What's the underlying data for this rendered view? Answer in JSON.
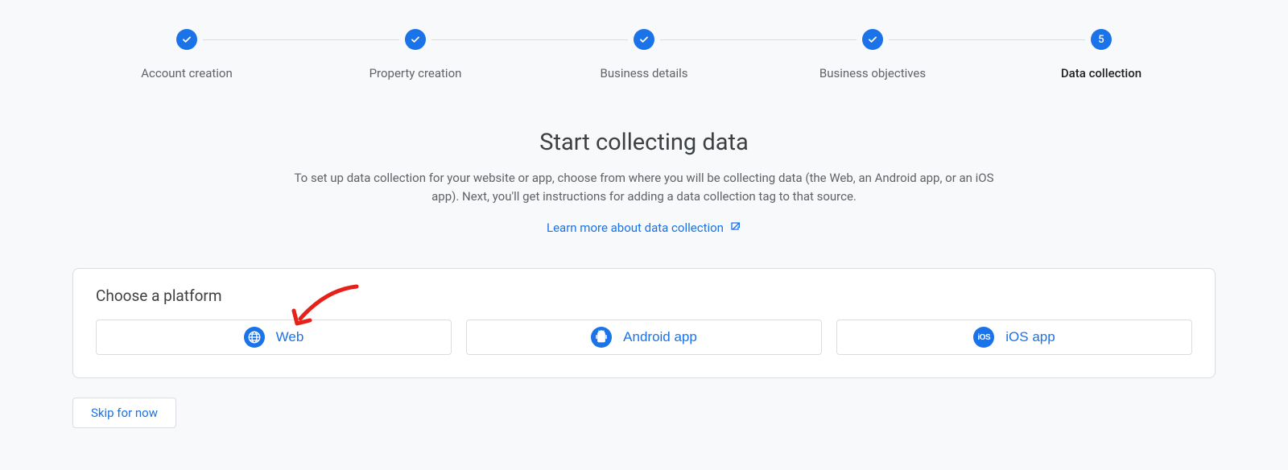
{
  "stepper": {
    "steps": [
      {
        "label": "Account creation",
        "completed": true
      },
      {
        "label": "Property creation",
        "completed": true
      },
      {
        "label": "Business details",
        "completed": true
      },
      {
        "label": "Business objectives",
        "completed": true
      },
      {
        "label": "Data collection",
        "number": "5",
        "active": true
      }
    ]
  },
  "main": {
    "heading": "Start collecting data",
    "description": "To set up data collection for your website or app, choose from where you will be collecting data (the Web, an Android app, or an iOS app). Next, you'll get instructions for adding a data collection tag to that source.",
    "learn_link": "Learn more about data collection"
  },
  "card": {
    "title": "Choose a platform",
    "platforms": [
      {
        "label": "Web",
        "icon": "globe-icon"
      },
      {
        "label": "Android app",
        "icon": "android-icon"
      },
      {
        "label": "iOS app",
        "icon": "ios-icon"
      }
    ]
  },
  "skip": {
    "label": "Skip for now"
  }
}
